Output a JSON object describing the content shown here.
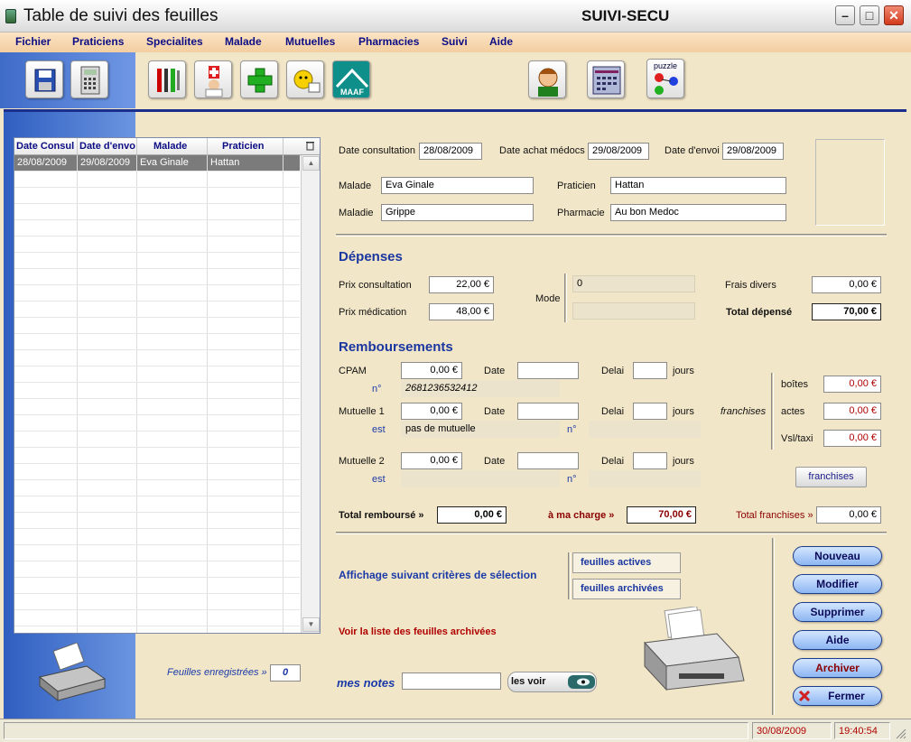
{
  "window": {
    "title": "Table de suivi des feuilles",
    "app_name": "SUIVI-SECU",
    "minimize": "–",
    "maximize": "□",
    "close": "✕"
  },
  "menu": [
    "Fichier",
    "Praticiens",
    "Specialites",
    "Malade",
    "Mutuelles",
    "Pharmacies",
    "Suivi",
    "Aide"
  ],
  "toolbar": {
    "left": [
      "save-icon",
      "calculator-icon"
    ],
    "main": [
      "tools-icon",
      "doctor-icon",
      "pharmacy-cross-icon",
      "patient-icon",
      "maaf-logo-icon"
    ],
    "right": [
      "contact-icon",
      "calendar-icon"
    ],
    "puzzle_label": "puzzle",
    "maaf_text": "MAAF"
  },
  "grid": {
    "columns": [
      "Date Consul",
      "Date d'envo",
      "Malade",
      "Praticien"
    ],
    "rows": [
      [
        "28/08/2009",
        "29/08/2009",
        "Eva Ginale",
        "Hattan"
      ]
    ]
  },
  "header": {
    "date_consultation_label": "Date consultation",
    "date_consultation": "28/08/2009",
    "date_achat_label": "Date achat médocs",
    "date_achat": "29/08/2009",
    "date_envoi_label": "Date d'envoi",
    "date_envoi": "29/08/2009",
    "malade_label": "Malade",
    "malade": "Eva Ginale",
    "praticien_label": "Praticien",
    "praticien": "Hattan",
    "maladie_label": "Maladie",
    "maladie": "Grippe",
    "pharmacie_label": "Pharmacie",
    "pharmacie": "Au bon Medoc"
  },
  "depenses": {
    "title": "Dépenses",
    "prix_consultation_label": "Prix consultation",
    "prix_consultation": "22,00 €",
    "prix_medication_label": "Prix médication",
    "prix_medication": "48,00 €",
    "mode_label": "Mode",
    "mode_value": "0",
    "frais_divers_label": "Frais divers",
    "frais_divers": "0,00 €",
    "total_label": "Total dépensé",
    "total": "70,00 €"
  },
  "remboursements": {
    "title": "Remboursements",
    "cpam_label": "CPAM",
    "cpam_amount": "0,00 €",
    "date_label": "Date",
    "delai_label": "Delai",
    "jours_label": "jours",
    "numero_label": "n°",
    "cpam_numero": "2681236532412",
    "mutuelle1_label": "Mutuelle 1",
    "mutuelle1_amount": "0,00 €",
    "est_label": "est",
    "mutuelle1_name": "pas de mutuelle",
    "mutuelle2_label": "Mutuelle 2",
    "mutuelle2_amount": "0,00 €",
    "franchises_label": "franchises",
    "boites_label": "boîtes",
    "boites": "0,00 €",
    "actes_label": "actes",
    "actes": "0,00 €",
    "vsl_label": "Vsl/taxi",
    "vsl": "0,00 €",
    "franchises_button": "franchises"
  },
  "totals": {
    "rembourse_label": "Total remboursé »",
    "rembourse": "0,00 €",
    "charge_label": "à ma charge »",
    "charge": "70,00 €",
    "franchises_label": "Total franchises »",
    "franchises": "0,00 €"
  },
  "selection": {
    "label": "Affichage suivant critères de sélection",
    "actives": "feuilles actives",
    "archivees": "feuilles archivées",
    "voir_archivees": "Voir la liste des feuilles archivées"
  },
  "actions": {
    "nouveau": "Nouveau",
    "modifier": "Modifier",
    "supprimer": "Supprimer",
    "aide": "Aide",
    "archiver": "Archiver",
    "fermer": "Fermer"
  },
  "footer": {
    "feuilles_label": "Feuilles enregistrées »",
    "feuilles_count": "0",
    "notes_label": "mes notes",
    "notes_value": "",
    "voir_button": "les voir"
  },
  "status": {
    "date": "30/08/2009",
    "time": "19:40:54"
  },
  "colors": {
    "background": "#f2e6c8",
    "panel_blue": "#3f6cc8",
    "title_blue": "#1a36a0",
    "alert_red": "#b00000"
  }
}
